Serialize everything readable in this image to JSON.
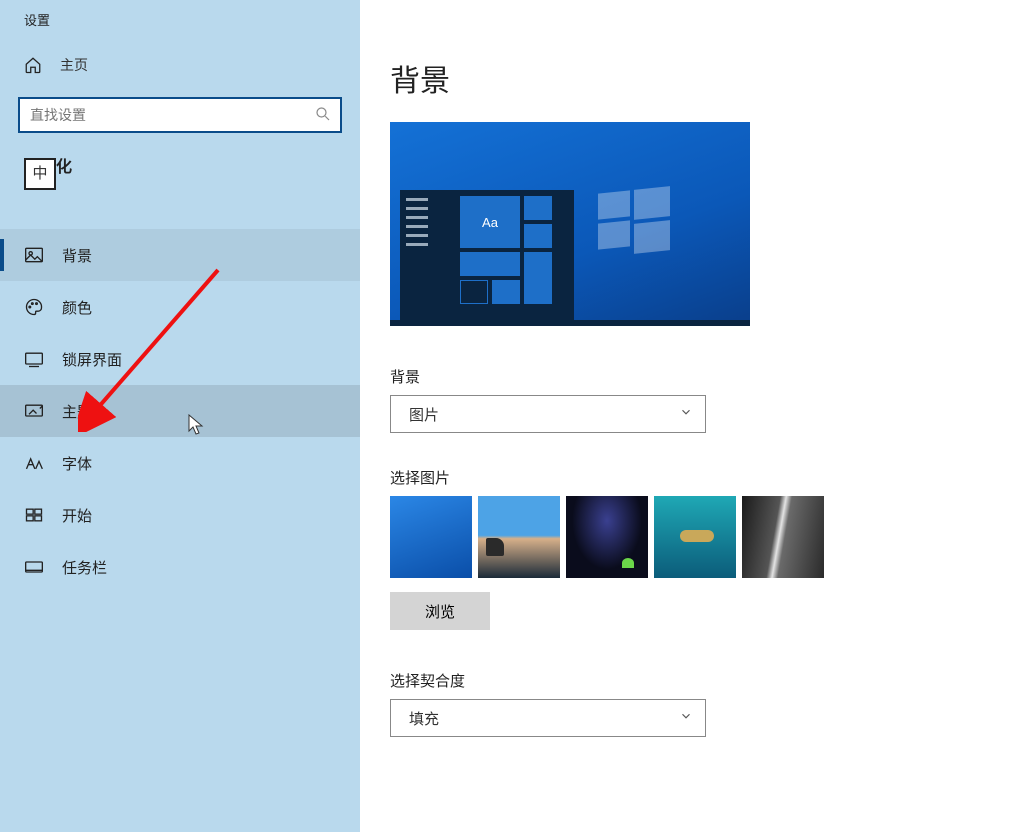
{
  "app_title": "设置",
  "home_label": "主页",
  "search_placeholder": "直找设置",
  "ime_badge": "中",
  "category_suffix": "化",
  "nav": {
    "background": "背景",
    "colors": "颜色",
    "lockscreen": "锁屏界面",
    "themes": "主题",
    "fonts": "字体",
    "start": "开始",
    "taskbar": "任务栏"
  },
  "page_title": "背景",
  "preview_aa": "Aa",
  "bg_label": "背景",
  "bg_dropdown_value": "图片",
  "choose_image_label": "选择图片",
  "browse_label": "浏览",
  "fit_label": "选择契合度",
  "fit_dropdown_value": "填充"
}
